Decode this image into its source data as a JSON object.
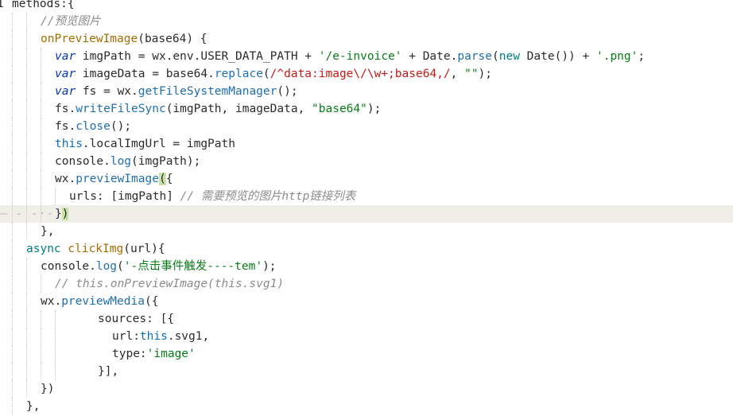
{
  "editor": {
    "gutter_number": "1",
    "whitespace_marker": "— - -·- -",
    "lines": [
      {
        "indent": 15,
        "tokens": [
          {
            "t": "methods:{",
            "c": "t-plain"
          }
        ]
      },
      {
        "indent": 51,
        "tokens": [
          {
            "t": "//预览图片",
            "c": "t-cmt"
          }
        ]
      },
      {
        "indent": 51,
        "tokens": [
          {
            "t": "onPreviewImage",
            "c": "t-fn"
          },
          {
            "t": "(base64) {",
            "c": "t-plain"
          }
        ]
      },
      {
        "indent": 69,
        "tokens": [
          {
            "t": "var",
            "c": "t-kw"
          },
          {
            "t": " imgPath = wx.env.USER_DATA_PATH + ",
            "c": "t-plain"
          },
          {
            "t": "'/e-invoice'",
            "c": "t-str"
          },
          {
            "t": " + Date.",
            "c": "t-plain"
          },
          {
            "t": "parse",
            "c": "t-mth"
          },
          {
            "t": "(",
            "c": "t-plain"
          },
          {
            "t": "new",
            "c": "t-kw2"
          },
          {
            "t": " Date()) + ",
            "c": "t-plain"
          },
          {
            "t": "'.png'",
            "c": "t-str"
          },
          {
            "t": ";",
            "c": "t-plain"
          }
        ]
      },
      {
        "indent": 69,
        "tokens": [
          {
            "t": "var",
            "c": "t-kw"
          },
          {
            "t": " imageData = base64.",
            "c": "t-plain"
          },
          {
            "t": "replace",
            "c": "t-mth"
          },
          {
            "t": "(",
            "c": "t-plain"
          },
          {
            "t": "/^data:image\\/\\w+;base64,/",
            "c": "t-re"
          },
          {
            "t": ", ",
            "c": "t-plain"
          },
          {
            "t": "\"\"",
            "c": "t-str"
          },
          {
            "t": ");",
            "c": "t-plain"
          }
        ]
      },
      {
        "indent": 69,
        "tokens": [
          {
            "t": "var",
            "c": "t-kw"
          },
          {
            "t": " fs = wx.",
            "c": "t-plain"
          },
          {
            "t": "getFileSystemManager",
            "c": "t-mth"
          },
          {
            "t": "();",
            "c": "t-plain"
          }
        ]
      },
      {
        "indent": 69,
        "tokens": [
          {
            "t": "fs.",
            "c": "t-plain"
          },
          {
            "t": "writeFileSync",
            "c": "t-mth"
          },
          {
            "t": "(imgPath, imageData, ",
            "c": "t-plain"
          },
          {
            "t": "\"base64\"",
            "c": "t-str"
          },
          {
            "t": ");",
            "c": "t-plain"
          }
        ]
      },
      {
        "indent": 69,
        "tokens": [
          {
            "t": "fs.",
            "c": "t-plain"
          },
          {
            "t": "close",
            "c": "t-mth"
          },
          {
            "t": "();",
            "c": "t-plain"
          }
        ]
      },
      {
        "indent": 69,
        "tokens": [
          {
            "t": "this",
            "c": "t-this"
          },
          {
            "t": ".localImgUrl = imgPath",
            "c": "t-plain"
          }
        ]
      },
      {
        "indent": 69,
        "tokens": [
          {
            "t": "console.",
            "c": "t-plain"
          },
          {
            "t": "log",
            "c": "t-mth"
          },
          {
            "t": "(imgPath);",
            "c": "t-plain"
          }
        ]
      },
      {
        "indent": 69,
        "tokens": [
          {
            "t": "wx.",
            "c": "t-plain"
          },
          {
            "t": "previewImage",
            "c": "t-mth"
          },
          {
            "t": "(",
            "c": "t-paren-hl"
          },
          {
            "t": "{",
            "c": "t-plain"
          }
        ]
      },
      {
        "indent": 87,
        "tokens": [
          {
            "t": "urls: [imgPath] ",
            "c": "t-plain"
          },
          {
            "t": "// 需要预览的图片http链接列表",
            "c": "t-cmt"
          }
        ]
      },
      {
        "indent": 69,
        "current": true,
        "tokens": [
          {
            "t": "}",
            "c": "t-plain"
          },
          {
            "t": ")",
            "c": "t-paren-hl"
          }
        ]
      },
      {
        "indent": 51,
        "tokens": [
          {
            "t": "},",
            "c": "t-plain"
          }
        ]
      },
      {
        "indent": 33,
        "tokens": [
          {
            "t": "async",
            "c": "t-kw2"
          },
          {
            "t": " ",
            "c": "t-plain"
          },
          {
            "t": "clickImg",
            "c": "t-fn"
          },
          {
            "t": "(url){",
            "c": "t-plain"
          }
        ]
      },
      {
        "indent": 51,
        "tokens": [
          {
            "t": "console.",
            "c": "t-plain"
          },
          {
            "t": "log",
            "c": "t-mth"
          },
          {
            "t": "(",
            "c": "t-plain"
          },
          {
            "t": "'-点击事件触发----tem'",
            "c": "t-str"
          },
          {
            "t": ");",
            "c": "t-plain"
          }
        ]
      },
      {
        "indent": 69,
        "tokens": [
          {
            "t": "// this.onPreviewImage(this.svg1)",
            "c": "t-cmt"
          }
        ]
      },
      {
        "indent": 51,
        "tokens": [
          {
            "t": "wx.",
            "c": "t-plain"
          },
          {
            "t": "previewMedia",
            "c": "t-mth"
          },
          {
            "t": "({",
            "c": "t-plain"
          }
        ]
      },
      {
        "indent": 123,
        "tokens": [
          {
            "t": "sources: [{",
            "c": "t-plain"
          }
        ]
      },
      {
        "indent": 141,
        "tokens": [
          {
            "t": "url:",
            "c": "t-plain"
          },
          {
            "t": "this",
            "c": "t-this"
          },
          {
            "t": ".svg1,",
            "c": "t-plain"
          }
        ]
      },
      {
        "indent": 141,
        "tokens": [
          {
            "t": "type:",
            "c": "t-plain"
          },
          {
            "t": "'image'",
            "c": "t-str"
          }
        ]
      },
      {
        "indent": 123,
        "tokens": [
          {
            "t": "}],",
            "c": "t-plain"
          }
        ]
      },
      {
        "indent": 51,
        "tokens": [
          {
            "t": "})",
            "c": "t-plain"
          }
        ]
      },
      {
        "indent": 33,
        "tokens": [
          {
            "t": "},",
            "c": "t-plain"
          }
        ]
      }
    ]
  }
}
